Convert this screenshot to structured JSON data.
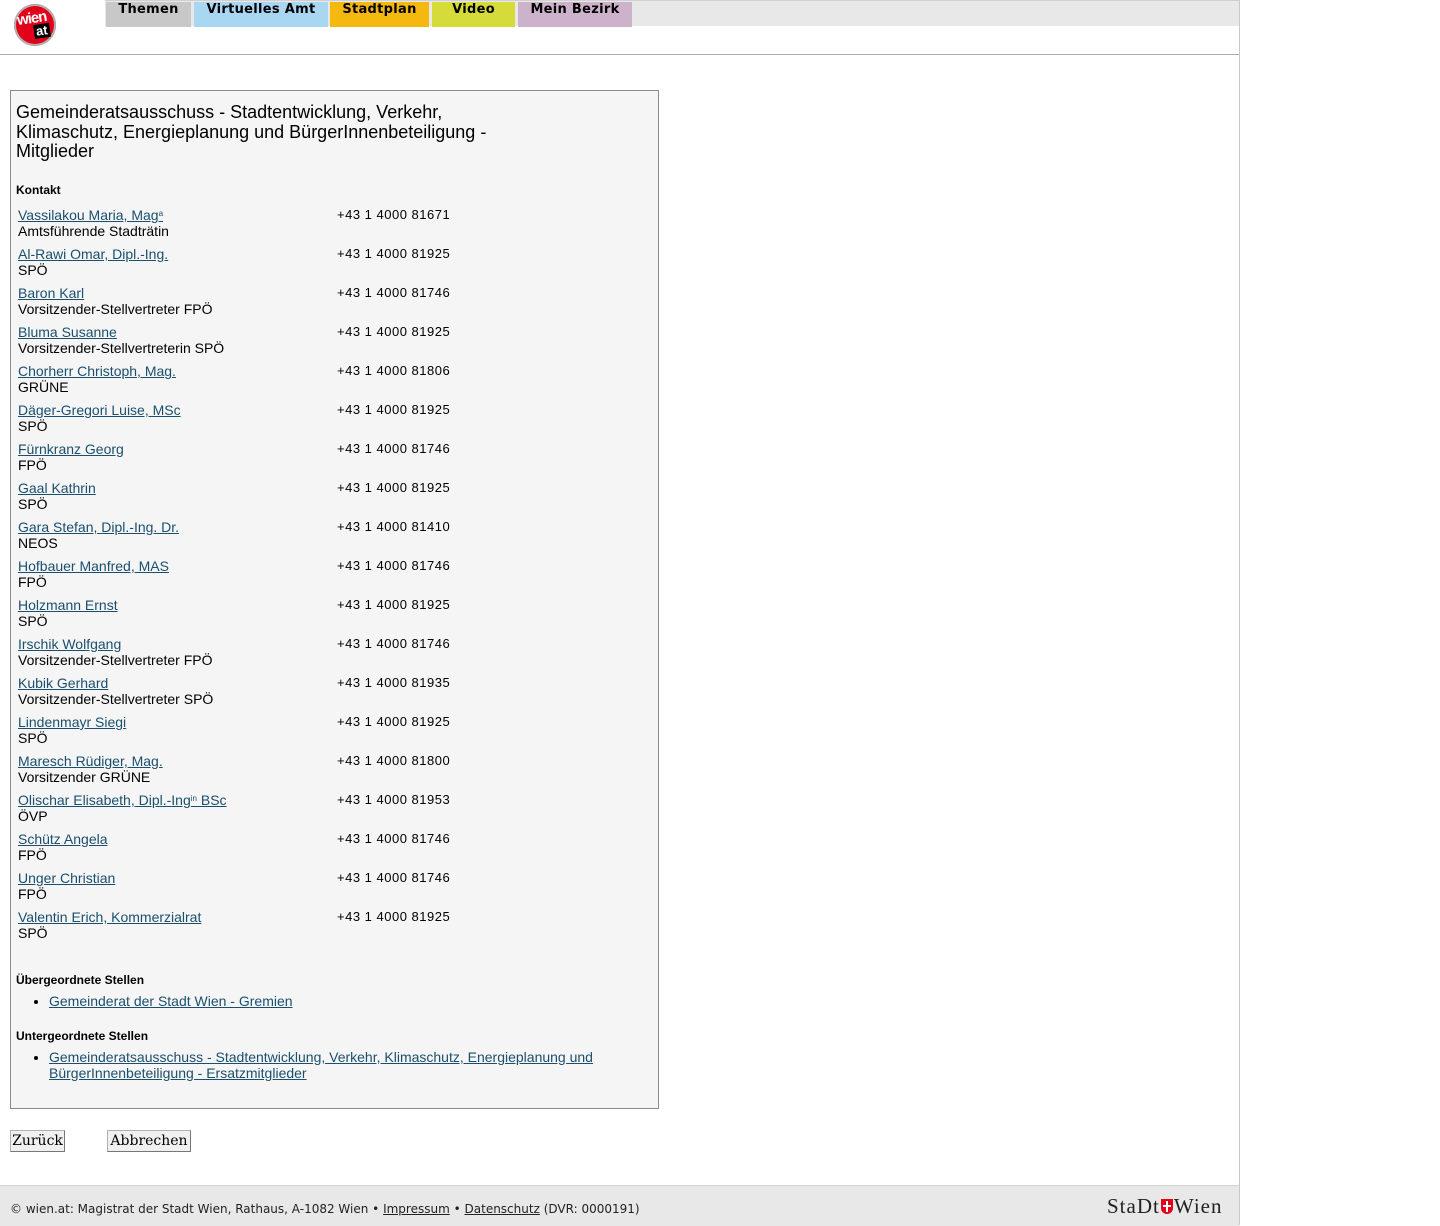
{
  "logo": {
    "line1": "wien",
    "line2": "at"
  },
  "nav": [
    {
      "label": "Themen",
      "color": "#c8c8c8"
    },
    {
      "label": "Virtuelles Amt",
      "color": "#a9d6f0"
    },
    {
      "label": "Stadtplan",
      "color": "#f5b80f"
    },
    {
      "label": "Video",
      "color": "#d5dc3a"
    },
    {
      "label": "Mein Bezirk",
      "color": "#cdb2cc"
    }
  ],
  "title": "Gemeinderatsausschuss - Stadtentwicklung, Verkehr, Klimaschutz, Energieplanung und BürgerInnenbeteiligung - Mitglieder",
  "kontakt_heading": "Kontakt",
  "members": [
    {
      "name": "Vassilakou Maria, Mag",
      "sup": "a",
      "name_suffix": "",
      "role": "Amtsführende Stadträtin",
      "phone": "+43 1 4000 81671"
    },
    {
      "name": "Al-Rawi Omar, Dipl.-Ing.",
      "sup": "",
      "name_suffix": "",
      "role": "SPÖ",
      "phone": "+43 1 4000 81925"
    },
    {
      "name": "Baron Karl",
      "sup": "",
      "name_suffix": "",
      "role": "Vorsitzender-Stellvertreter FPÖ",
      "phone": "+43 1 4000 81746"
    },
    {
      "name": "Bluma Susanne",
      "sup": "",
      "name_suffix": "",
      "role": "Vorsitzender-Stellvertreterin SPÖ",
      "phone": "+43 1 4000 81925"
    },
    {
      "name": "Chorherr Christoph, Mag.",
      "sup": "",
      "name_suffix": "",
      "role": "GRÜNE",
      "phone": "+43 1 4000 81806"
    },
    {
      "name": "Däger-Gregori Luise, MSc",
      "sup": "",
      "name_suffix": "",
      "role": "SPÖ",
      "phone": "+43 1 4000 81925"
    },
    {
      "name": "Fürnkranz Georg",
      "sup": "",
      "name_suffix": "",
      "role": "FPÖ",
      "phone": "+43 1 4000 81746"
    },
    {
      "name": "Gaal Kathrin",
      "sup": "",
      "name_suffix": "",
      "role": "SPÖ",
      "phone": "+43 1 4000 81925"
    },
    {
      "name": "Gara Stefan, Dipl.-Ing. Dr.",
      "sup": "",
      "name_suffix": "",
      "role": "NEOS",
      "phone": "+43 1 4000 81410"
    },
    {
      "name": "Hofbauer Manfred, MAS",
      "sup": "",
      "name_suffix": "",
      "role": "FPÖ",
      "phone": "+43 1 4000 81746"
    },
    {
      "name": "Holzmann Ernst",
      "sup": "",
      "name_suffix": "",
      "role": "SPÖ",
      "phone": "+43 1 4000 81925"
    },
    {
      "name": "Irschik Wolfgang",
      "sup": "",
      "name_suffix": "",
      "role": "Vorsitzender-Stellvertreter FPÖ",
      "phone": "+43 1 4000 81746"
    },
    {
      "name": "Kubik Gerhard",
      "sup": "",
      "name_suffix": "",
      "role": "Vorsitzender-Stellvertreter SPÖ",
      "phone": "+43 1 4000 81935"
    },
    {
      "name": "Lindenmayr Siegi",
      "sup": "",
      "name_suffix": "",
      "role": "SPÖ",
      "phone": "+43 1 4000 81925"
    },
    {
      "name": "Maresch Rüdiger, Mag.",
      "sup": "",
      "name_suffix": "",
      "role": "Vorsitzender GRÜNE",
      "phone": "+43 1 4000 81800"
    },
    {
      "name": "Olischar Elisabeth, Dipl.-Ing",
      "sup": "in",
      "name_suffix": " BSc",
      "role": "ÖVP",
      "phone": "+43 1 4000 81953"
    },
    {
      "name": "Schütz Angela",
      "sup": "",
      "name_suffix": "",
      "role": "FPÖ",
      "phone": "+43 1 4000 81746"
    },
    {
      "name": "Unger Christian",
      "sup": "",
      "name_suffix": "",
      "role": "FPÖ",
      "phone": "+43 1 4000 81746"
    },
    {
      "name": "Valentin Erich, Kommerzialrat",
      "sup": "",
      "name_suffix": "",
      "role": "SPÖ",
      "phone": "+43 1 4000 81925"
    }
  ],
  "parent_heading": "Übergeordnete Stellen",
  "parent_links": [
    "Gemeinderat der Stadt Wien - Gremien"
  ],
  "child_heading": "Untergeordnete Stellen",
  "child_links": [
    "Gemeinderatsausschuss - Stadtentwicklung, Verkehr, Klimaschutz, Energieplanung und BürgerInnenbeteiligung - Ersatzmitglieder"
  ],
  "buttons": {
    "back": "Zurück",
    "cancel": "Abbrechen"
  },
  "footer": {
    "prefix": "© wien.at: Magistrat der Stadt Wien, Rathaus, A-1082 Wien •",
    "impressum": "Impressum",
    "sep": "•",
    "datenschutz": "Datenschutz",
    "dvr": "(DVR: 0000191)",
    "brand_left": "StaDt",
    "brand_right": "Wien"
  }
}
